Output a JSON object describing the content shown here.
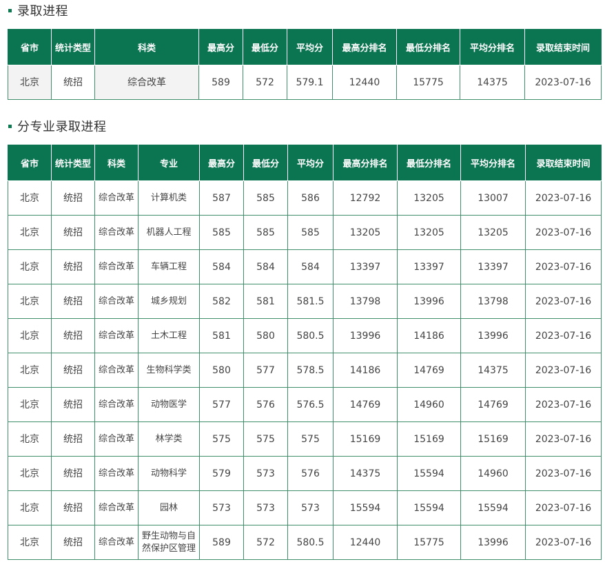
{
  "section1": {
    "title": "录取进程",
    "headers": [
      "省市",
      "统计类型",
      "科类",
      "最高分",
      "最低分",
      "平均分",
      "最高分排名",
      "最低分排名",
      "平均分排名",
      "录取结束时间"
    ],
    "rows": [
      [
        "北京",
        "统招",
        "综合改革",
        "589",
        "572",
        "579.1",
        "12440",
        "15775",
        "14375",
        "2023-07-16"
      ]
    ]
  },
  "section2": {
    "title": "分专业录取进程",
    "headers": [
      "省市",
      "统计类型",
      "科类",
      "专业",
      "最高分",
      "最低分",
      "平均分",
      "最高分排名",
      "最低分排名",
      "平均分排名",
      "录取结束时间"
    ],
    "rows": [
      [
        "北京",
        "统招",
        "综合改革",
        "计算机类",
        "587",
        "585",
        "586",
        "12792",
        "13205",
        "13007",
        "2023-07-16"
      ],
      [
        "北京",
        "统招",
        "综合改革",
        "机器人工程",
        "585",
        "585",
        "585",
        "13205",
        "13205",
        "13205",
        "2023-07-16"
      ],
      [
        "北京",
        "统招",
        "综合改革",
        "车辆工程",
        "584",
        "584",
        "584",
        "13397",
        "13397",
        "13397",
        "2023-07-16"
      ],
      [
        "北京",
        "统招",
        "综合改革",
        "城乡规划",
        "582",
        "581",
        "581.5",
        "13798",
        "13996",
        "13798",
        "2023-07-16"
      ],
      [
        "北京",
        "统招",
        "综合改革",
        "土木工程",
        "581",
        "580",
        "580.5",
        "13996",
        "14186",
        "13996",
        "2023-07-16"
      ],
      [
        "北京",
        "统招",
        "综合改革",
        "生物科学类",
        "580",
        "577",
        "578.5",
        "14186",
        "14769",
        "14375",
        "2023-07-16"
      ],
      [
        "北京",
        "统招",
        "综合改革",
        "动物医学",
        "577",
        "576",
        "576.5",
        "14769",
        "14960",
        "14769",
        "2023-07-16"
      ],
      [
        "北京",
        "统招",
        "综合改革",
        "林学类",
        "575",
        "575",
        "575",
        "15169",
        "15169",
        "15169",
        "2023-07-16"
      ],
      [
        "北京",
        "统招",
        "综合改革",
        "动物科学",
        "579",
        "573",
        "576",
        "14375",
        "15594",
        "14960",
        "2023-07-16"
      ],
      [
        "北京",
        "统招",
        "综合改革",
        "园林",
        "573",
        "573",
        "573",
        "15594",
        "15594",
        "15594",
        "2023-07-16"
      ],
      [
        "北京",
        "统招",
        "综合改革",
        "野生动物与自然保护区管理",
        "589",
        "572",
        "580.5",
        "12440",
        "15775",
        "13996",
        "2023-07-16"
      ]
    ]
  },
  "colors": {
    "header_bg": "#0b7551",
    "header_text": "#ffffff",
    "border": "#3e8e6a",
    "marker": "#0d7a52",
    "shaded_cell": "#f3f3f3"
  }
}
